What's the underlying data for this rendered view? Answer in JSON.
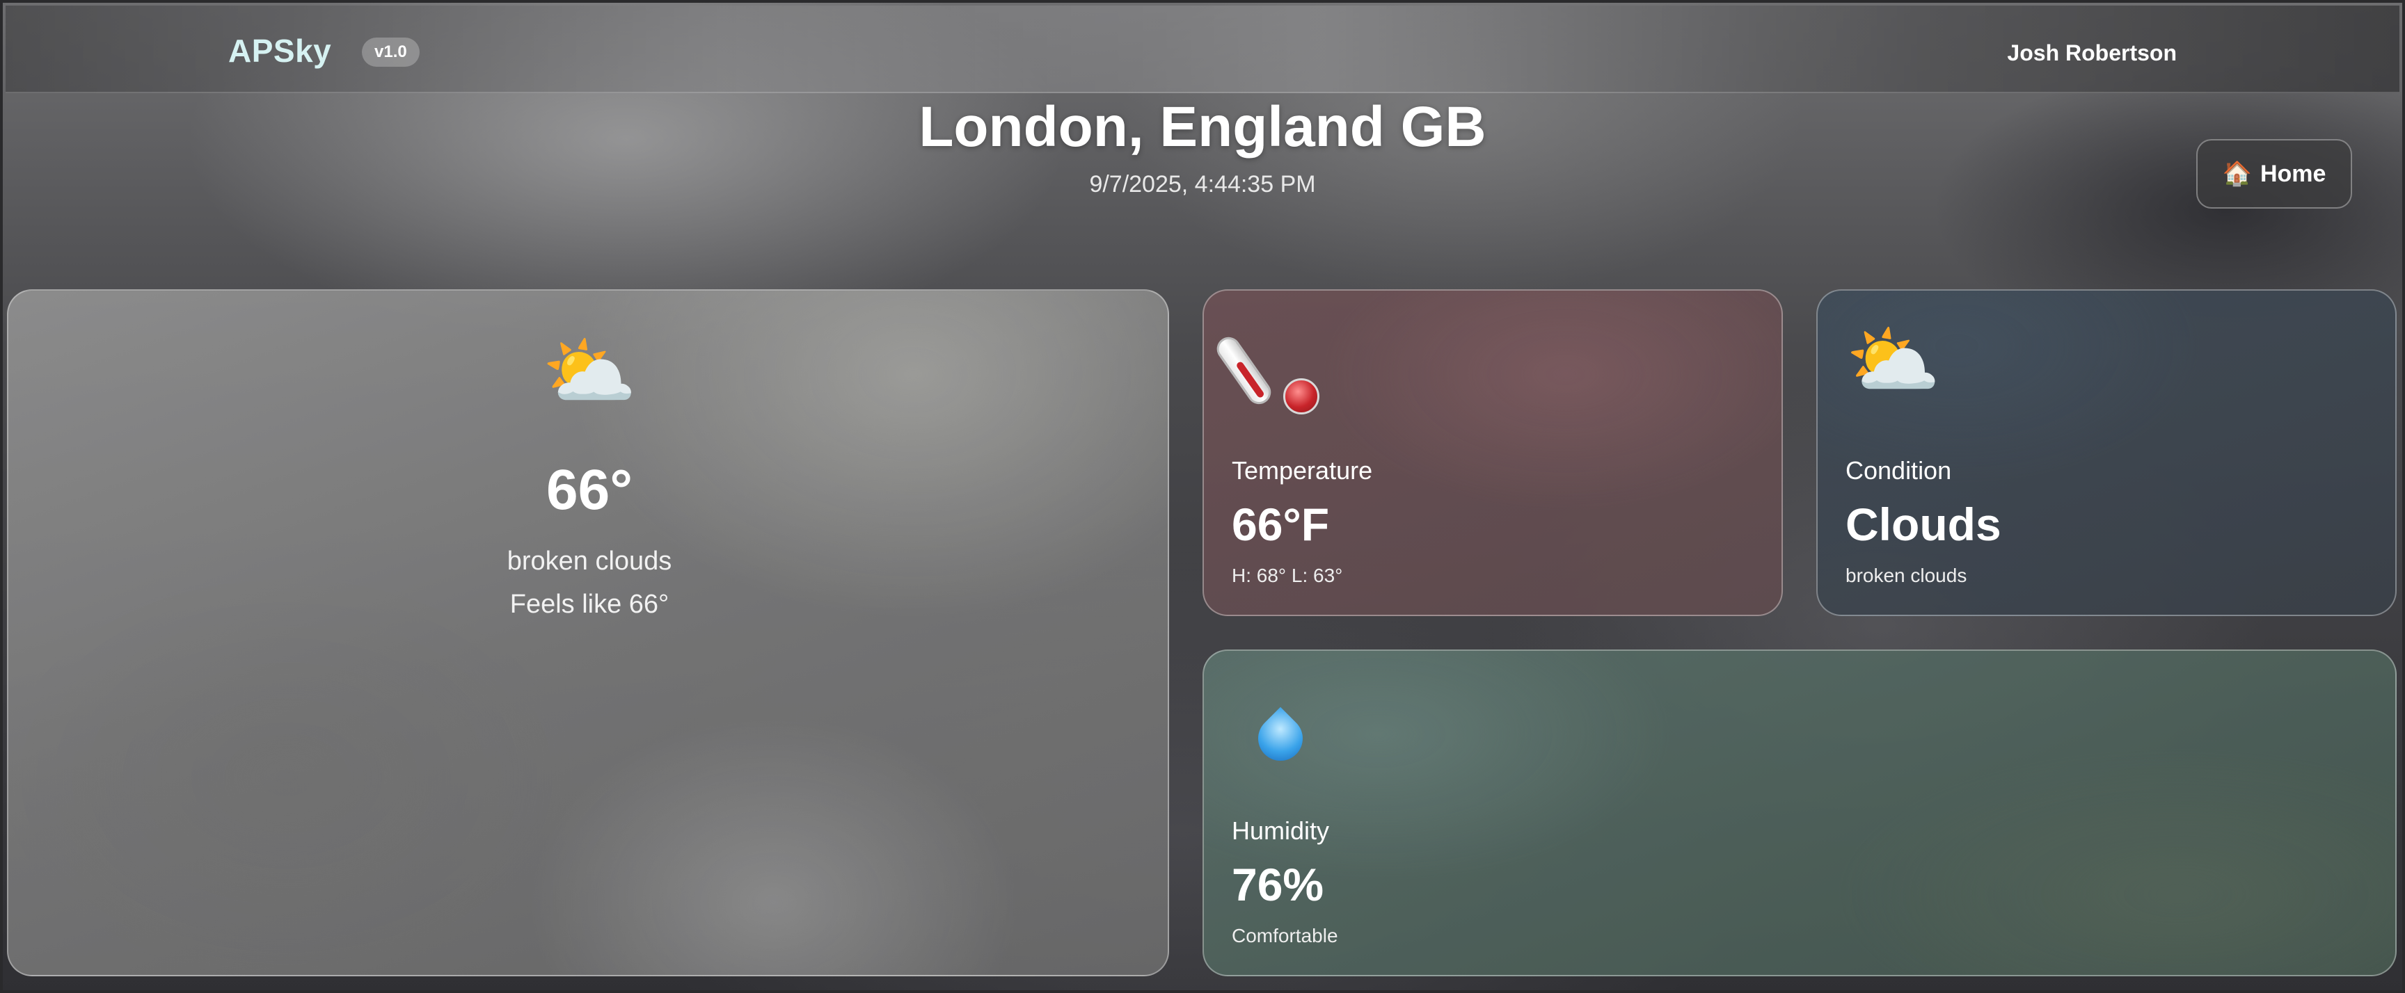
{
  "navbar": {
    "brand": "APSky",
    "version": "v1.0",
    "user_name": "Josh Robertson"
  },
  "header": {
    "city": "London, England GB",
    "datetime": "9/7/2025, 4:44:35 PM",
    "home_button": {
      "icon": "house-icon",
      "label": "Home"
    }
  },
  "main_card": {
    "icon": "sun-behind-cloud-icon",
    "icon_glyph": "⛅",
    "temperature": "66°",
    "description": "broken clouds",
    "feels_like": "Feels like 66°"
  },
  "temperature_card": {
    "icon": "thermometer-icon",
    "label": "Temperature",
    "value": "66°F",
    "sub": "H: 68° L: 63°"
  },
  "condition_card": {
    "icon": "sun-behind-cloud-icon",
    "icon_glyph": "⛅",
    "label": "Condition",
    "value": "Clouds",
    "sub": "broken clouds"
  },
  "humidity_card": {
    "icon": "droplet-icon",
    "label": "Humidity",
    "value": "76%",
    "sub": "Comfortable"
  },
  "colors": {
    "brand": "#d6f2f2",
    "temperature_card": "#6c5054",
    "condition_card": "#3e4a56",
    "humidity_card": "#586e68"
  }
}
